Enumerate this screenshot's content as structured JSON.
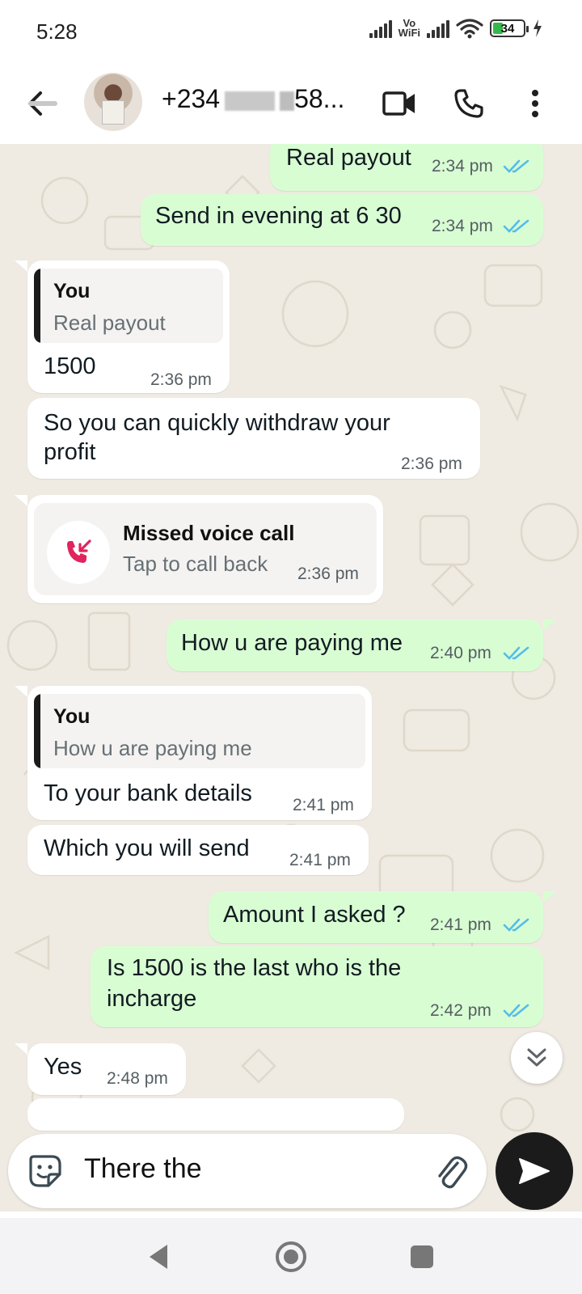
{
  "status_bar": {
    "time": "5:28",
    "vowifi_top": "Vo",
    "vowifi_bottom": "WiFi",
    "battery": "34",
    "battery_level": 0.34
  },
  "header": {
    "contact_prefix": "+234",
    "contact_suffix": "58...",
    "icons": [
      "back-arrow-icon",
      "video-call-icon",
      "voice-call-icon",
      "more-options-icon"
    ]
  },
  "messages": [
    {
      "dir": "out",
      "text": "Real payout",
      "time": "2:34 pm"
    },
    {
      "dir": "out",
      "text": "Send in evening at 6 30",
      "time": "2:34 pm"
    },
    {
      "dir": "in",
      "quote_author": "You",
      "quote_text": "Real payout",
      "text": "1500",
      "time": "2:36 pm"
    },
    {
      "dir": "in",
      "text_line1": "So you can quickly withdraw your",
      "text_line2": "profit",
      "time": "2:36 pm"
    },
    {
      "dir": "in",
      "type": "call",
      "call_title": "Missed voice call",
      "call_sub": "Tap to call back",
      "time": "2:36 pm"
    },
    {
      "dir": "out",
      "text": "How u are paying me",
      "time": "2:40 pm"
    },
    {
      "dir": "in",
      "quote_author": "You",
      "quote_text": "How u are paying me",
      "text": "To your bank details",
      "time": "2:41 pm"
    },
    {
      "dir": "in",
      "text": "Which you will send",
      "time": "2:41 pm"
    },
    {
      "dir": "out",
      "text": "Amount I asked ?",
      "time": "2:41 pm"
    },
    {
      "dir": "out",
      "text_line1": "Is 1500 is the last who is the",
      "text_line2": "incharge",
      "time": "2:42 pm"
    },
    {
      "dir": "in",
      "text": "Yes",
      "time": "2:48 pm"
    }
  ],
  "composer": {
    "input_value": "There the",
    "icons": [
      "sticker-icon",
      "attach-icon",
      "send-icon"
    ]
  },
  "colors": {
    "outgoing_bubble": "#d9fdd3",
    "incoming_bubble": "#ffffff",
    "chat_background": "#efeae2",
    "read_ticks": "#53bdeb",
    "missed_call": "#e0245e"
  },
  "nav": {
    "icons": [
      "back-nav-icon",
      "home-nav-icon",
      "recents-nav-icon"
    ]
  }
}
